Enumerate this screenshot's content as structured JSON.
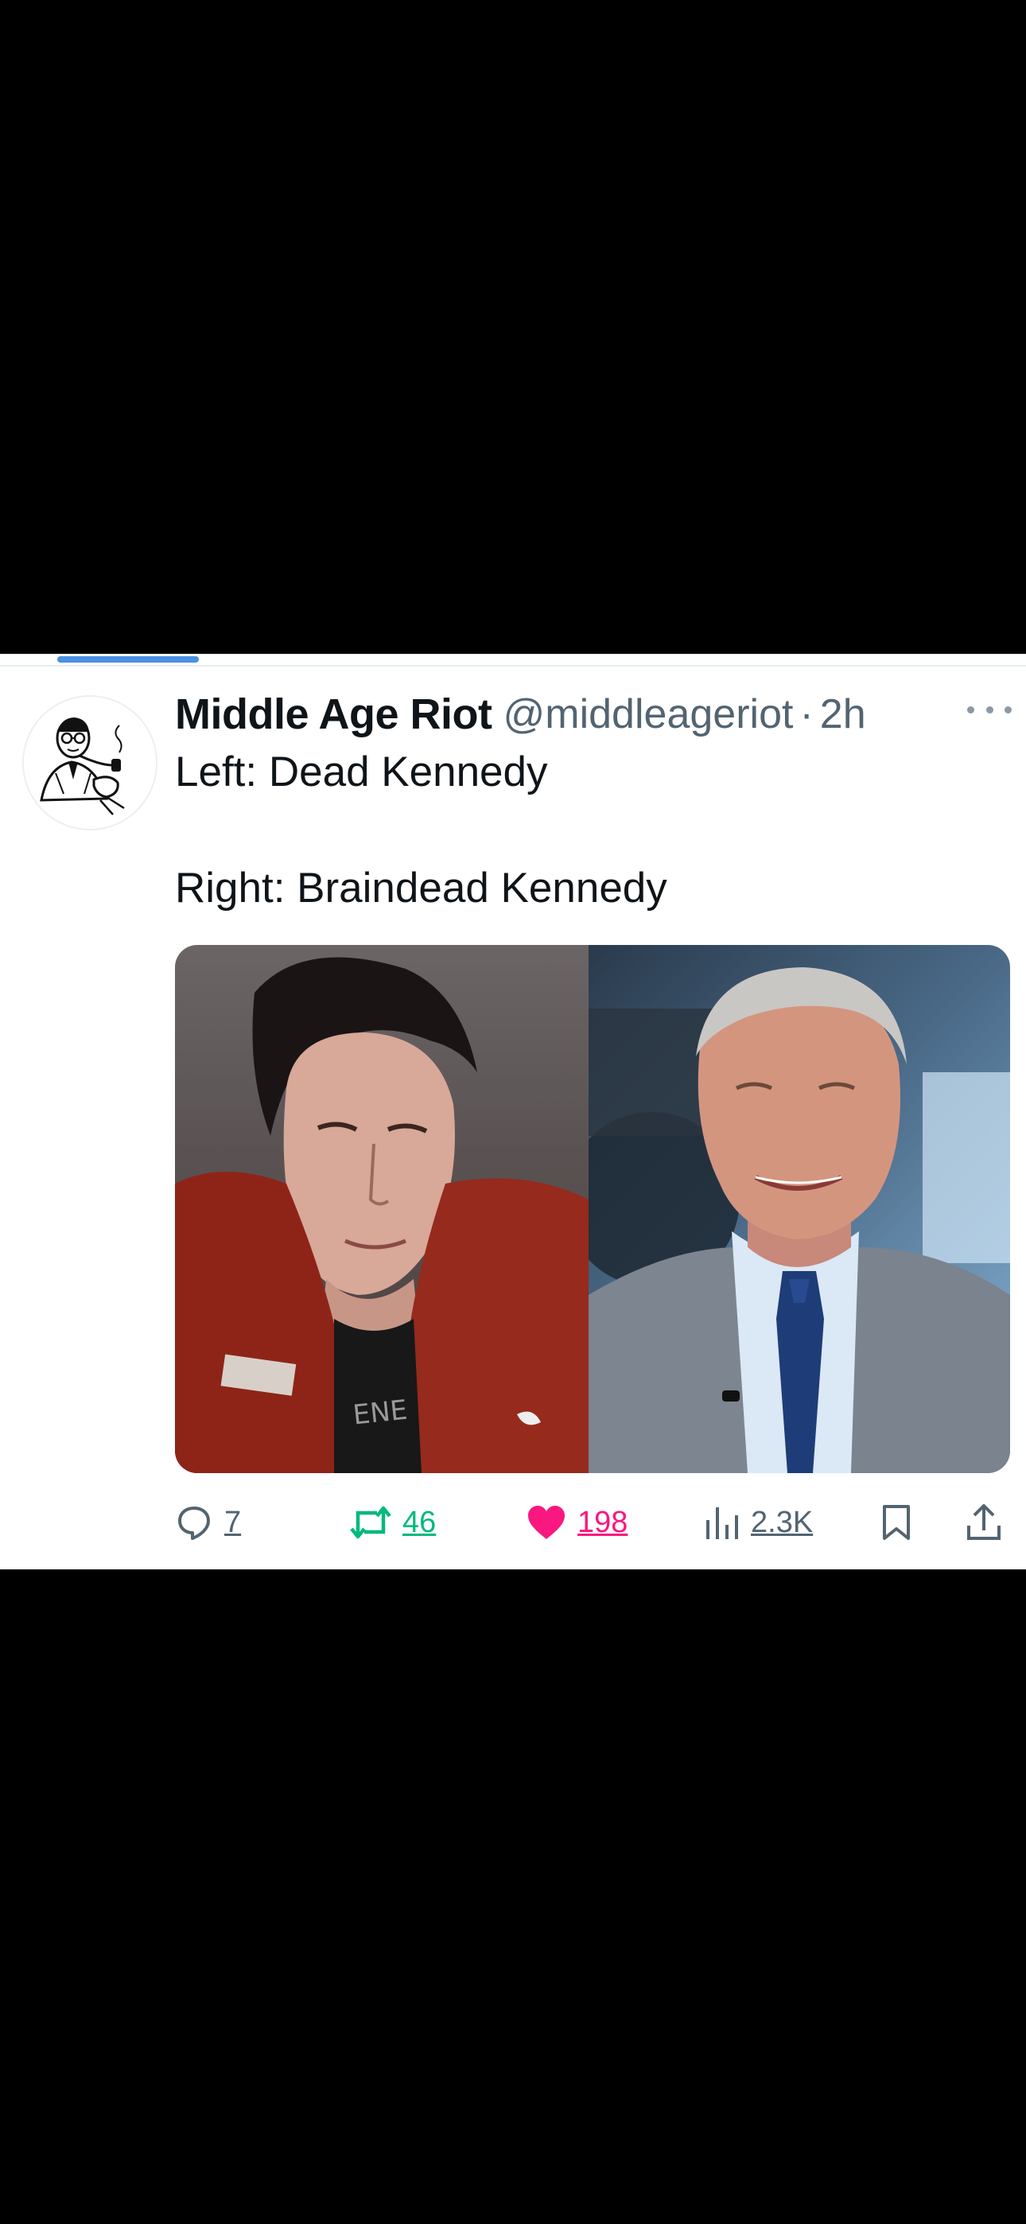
{
  "tweet": {
    "author": {
      "display_name": "Middle Age Riot",
      "handle": "@middleageriot",
      "separator": "·",
      "time": "2h",
      "avatar_icon": "man-with-pipe-sketch-icon"
    },
    "text_lines": [
      "Left: Dead Kennedy",
      "Right: Braindead Kennedy"
    ],
    "media": {
      "left_image": "young-man-red-jacket-photo",
      "right_image": "older-man-grey-suit-photo"
    },
    "actions": {
      "replies": "7",
      "reposts": "46",
      "likes": "198",
      "views": "2.3K"
    }
  },
  "colors": {
    "text_primary": "#0f1419",
    "text_secondary": "#536471",
    "repost_green": "#00ba7c",
    "like_pink": "#f91880",
    "progress_blue": "#4a90e2"
  }
}
